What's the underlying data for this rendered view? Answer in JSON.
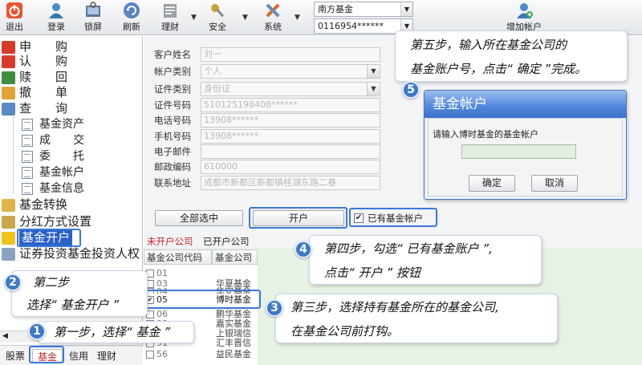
{
  "toolbar": {
    "buttons": [
      {
        "label": "退出",
        "icon": "power-icon"
      },
      {
        "label": "登录",
        "icon": "user-icon"
      },
      {
        "label": "锁屏",
        "icon": "lock-screen-icon"
      },
      {
        "label": "刷新",
        "icon": "refresh-icon"
      },
      {
        "label": "理财",
        "icon": "finance-icon"
      },
      {
        "label": "安全",
        "icon": "security-icon"
      },
      {
        "label": "系统",
        "icon": "system-icon"
      }
    ],
    "company_select": "南方基金",
    "account_select": "0116954******",
    "add_account": "增加帐户"
  },
  "nav": {
    "items": [
      "申　　购",
      "认　　购",
      "赎　　回",
      "撤　　单",
      "查　　询"
    ],
    "sub_items": [
      "基金资产",
      "成　　交",
      "委　　托",
      "基金帐户",
      "基金信息"
    ],
    "more_items": [
      "基金转换",
      "分红方式设置",
      "基金开户",
      "证券投资基金投资人权"
    ]
  },
  "bottom_tabs": [
    "股票",
    "基金",
    "信用",
    "理财"
  ],
  "form": {
    "fields": [
      {
        "label": "客户姓名",
        "value": "刘一"
      },
      {
        "label": "帐户类别",
        "value": "个人"
      },
      {
        "label": "证件类别",
        "value": "身份证"
      },
      {
        "label": "证件号码",
        "value": "510125198408******"
      },
      {
        "label": "电话号码",
        "value": "13908******"
      },
      {
        "label": "手机号码",
        "value": "13908******"
      },
      {
        "label": "电子邮件",
        "value": ""
      },
      {
        "label": "邮政编码",
        "value": "610000"
      },
      {
        "label": "联系地址",
        "value": "成都市新都区新都镇桂湖东路二巷"
      }
    ],
    "select_all": "全部选中",
    "open_button": "开户",
    "has_account": "已有基金帐户"
  },
  "tabs": {
    "unopened": "未开户公司",
    "opened": "已开户公司"
  },
  "table": {
    "headers": [
      "基金公司代码",
      "基金公司"
    ],
    "rows": [
      {
        "code": "01",
        "name": ""
      },
      {
        "code": "03",
        "name": "华夏基金"
      },
      {
        "code": "04",
        "name": "华安基金"
      },
      {
        "code": "05",
        "name": "博时基金",
        "checked": true
      },
      {
        "code": "06",
        "name": "鹏华基金"
      },
      {
        "code": "09",
        "name": "嘉实基金"
      },
      {
        "code": "10",
        "name": "上银瑞信"
      },
      {
        "code": "51",
        "name": "汇丰晋信"
      },
      {
        "code": "56",
        "name": "益民基金"
      }
    ]
  },
  "dialog": {
    "title": "基金帐户",
    "prompt": "请输入博时基金的基金帐户",
    "ok": "确定",
    "cancel": "取消"
  },
  "callouts": {
    "step1": {
      "num": "1",
      "text": "第一步，选择“ 基金 ”"
    },
    "step2": {
      "num": "2",
      "line1": "第二步",
      "line2": "选择“ 基金开户 ”"
    },
    "step3": {
      "num": "3",
      "line1": "第三步，选择持有基金所在的基金公司,",
      "line2": "在基金公司前打钩。"
    },
    "step4": {
      "num": "4",
      "line1": "第四步，勾选“ 已有基金账户 ”,",
      "line2": "点击“ 开户 ” 按钮"
    },
    "step5": {
      "num": "5",
      "line1": "第五步，输入所在基金公司的",
      "line2": "基金账户号，点击“ 确定 ”完成。"
    }
  },
  "colors": {
    "accent": "#3a78d8",
    "callout_num": "#3f79c6",
    "grid_bg": "#e7f2e4",
    "active_tab_text": "#c0282a"
  }
}
